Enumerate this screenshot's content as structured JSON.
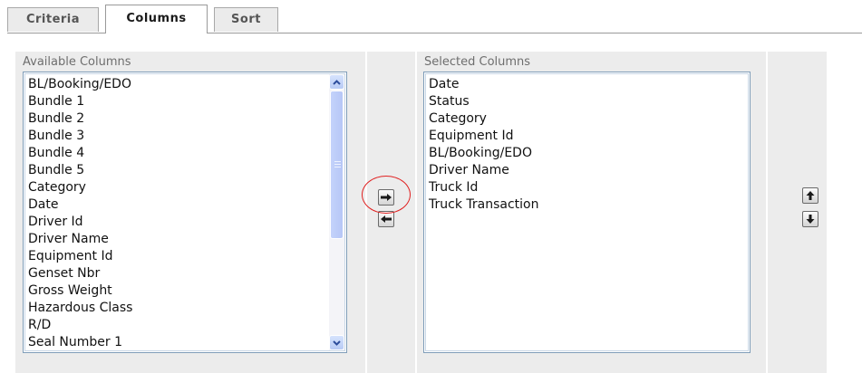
{
  "tabs": [
    {
      "label": "Criteria",
      "active": false
    },
    {
      "label": "Columns",
      "active": true
    },
    {
      "label": "Sort",
      "active": false
    }
  ],
  "available": {
    "label": "Available Columns",
    "items": [
      "BL/Booking/EDO",
      "Bundle 1",
      "Bundle 2",
      "Bundle 3",
      "Bundle 4",
      "Bundle 5",
      "Category",
      "Date",
      "Driver Id",
      "Driver Name",
      "Equipment Id",
      "Genset Nbr",
      "Gross Weight",
      "Hazardous Class",
      "R/D",
      "Seal Number 1"
    ]
  },
  "selected": {
    "label": "Selected Columns",
    "items": [
      "Date",
      "Status",
      "Category",
      "Equipment Id",
      "BL/Booking/EDO",
      "Driver Name",
      "Truck Id",
      "Truck Transaction"
    ]
  },
  "icons": {
    "add": "arrow-right-icon",
    "remove": "arrow-left-icon",
    "move_up": "arrow-up-icon",
    "move_down": "arrow-down-icon"
  },
  "colors": {
    "highlight_ring": "#e02020",
    "panel_bg": "#ececec",
    "listbox_border": "#7f9db9",
    "scrollbar": "#c4d3fb"
  }
}
